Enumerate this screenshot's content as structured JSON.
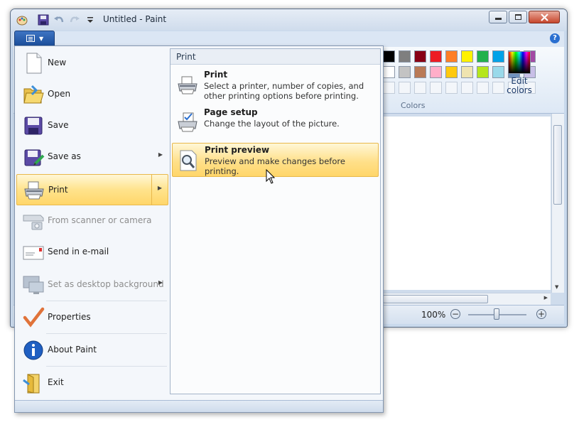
{
  "window": {
    "title": "Untitled - Paint",
    "help": "?"
  },
  "ribbon": {
    "colors_label": "Colors",
    "edit_colors_label": "Edit colors",
    "palette_row1": [
      "#000000",
      "#7f7f7f",
      "#880015",
      "#ed1c24",
      "#ff7f27",
      "#fff200",
      "#22b14c",
      "#00a2e8",
      "#3f48cc",
      "#a349a4"
    ],
    "palette_row2": [
      "#ffffff",
      "#c3c3c3",
      "#b97a57",
      "#ffaec9",
      "#ffc90e",
      "#efe4b0",
      "#b5e61d",
      "#99d9ea",
      "#7092be",
      "#c8bfe7"
    ]
  },
  "statusbar": {
    "zoom": "100%",
    "zoom_out": "−",
    "zoom_in": "+"
  },
  "app_menu": {
    "items": [
      {
        "label": "New",
        "icon": "new-document-icon",
        "enabled": true
      },
      {
        "label": "Open",
        "icon": "open-folder-icon",
        "enabled": true
      },
      {
        "label": "Save",
        "icon": "save-disk-icon",
        "enabled": true
      },
      {
        "label": "Save as",
        "icon": "save-as-icon",
        "enabled": true,
        "submenu": true
      },
      {
        "label": "Print",
        "icon": "printer-icon",
        "enabled": true,
        "submenu": true,
        "highlighted": true
      },
      {
        "label": "From scanner or camera",
        "icon": "scanner-icon",
        "enabled": false
      },
      {
        "label": "Send in e-mail",
        "icon": "email-icon",
        "enabled": true
      },
      {
        "label": "Set as desktop background",
        "icon": "desktop-icon",
        "enabled": false,
        "submenu": true
      },
      {
        "label": "Properties",
        "icon": "checkmark-icon",
        "enabled": true
      },
      {
        "label": "About Paint",
        "icon": "info-icon",
        "enabled": true
      },
      {
        "label": "Exit",
        "icon": "exit-icon",
        "enabled": true
      }
    ],
    "submenu": {
      "header": "Print",
      "items": [
        {
          "title": "Print",
          "description": "Select a printer, number of copies, and other printing options before printing.",
          "icon": "printer-icon"
        },
        {
          "title": "Page setup",
          "description": "Change the layout of the picture.",
          "icon": "page-setup-icon"
        },
        {
          "title": "Print preview",
          "description": "Preview and make changes before printing.",
          "icon": "print-preview-icon",
          "highlighted": true
        }
      ]
    }
  }
}
